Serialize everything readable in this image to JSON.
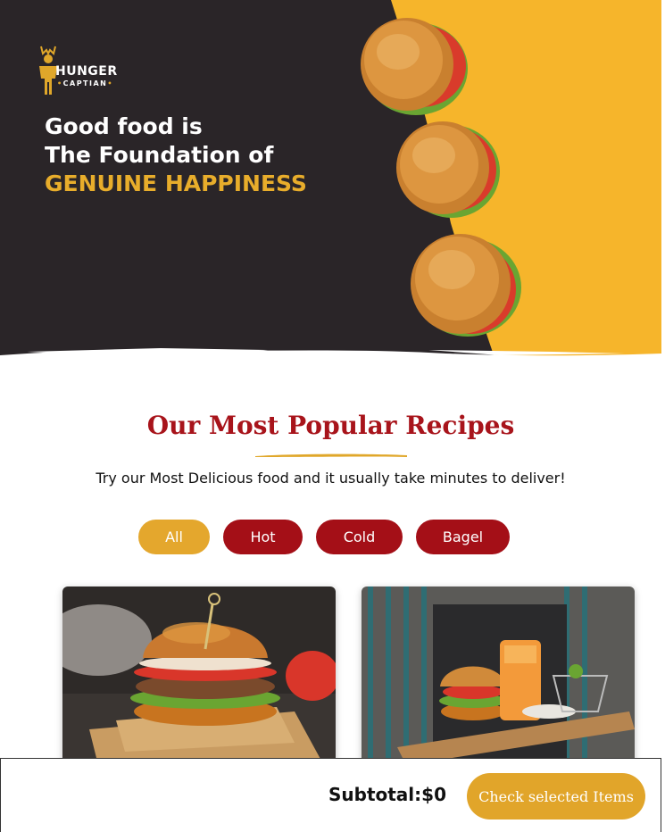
{
  "brand": {
    "name_top": "HUNGER",
    "name_bottom": "CAPTIAN"
  },
  "hero": {
    "line1": "Good food is",
    "line2": "The Foundation of",
    "line3": "GENUINE HAPPINESS"
  },
  "recipes": {
    "title": "Our Most Popular Recipes",
    "subtitle": "Try our Most Delicious food and it usually take minutes to deliver!"
  },
  "filters": [
    {
      "label": "All"
    },
    {
      "label": "Hot"
    },
    {
      "label": "Cold"
    },
    {
      "label": "Bagel"
    }
  ],
  "footer": {
    "subtotal": "Subtotal:$0",
    "check_button": "Check selected Items"
  },
  "colors": {
    "brand_yellow": "#e4a72d",
    "brand_red": "#a40f17",
    "hero_dark": "#2a2528",
    "hero_yellow": "#f6b52b"
  }
}
